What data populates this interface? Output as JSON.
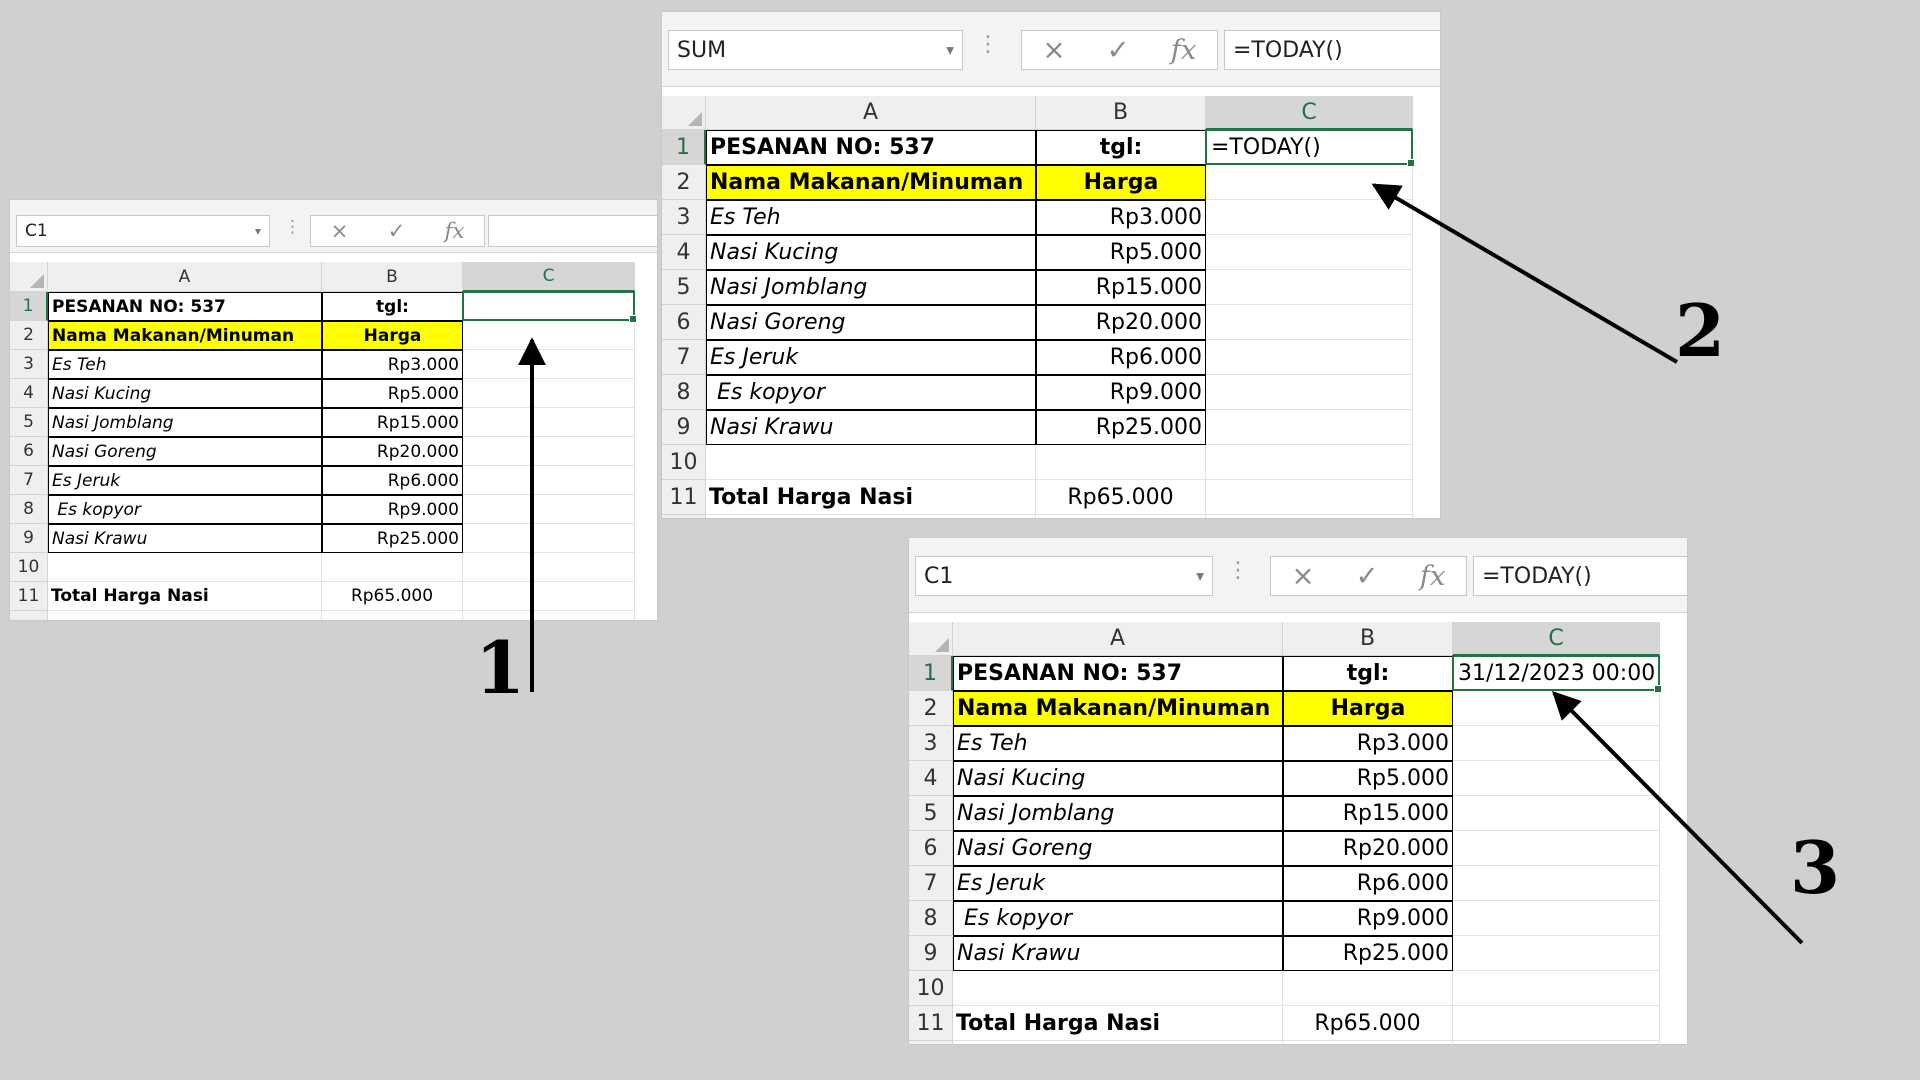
{
  "panels": [
    {
      "name_box": "C1",
      "formula": "",
      "active_value": "",
      "columns": [
        "A",
        "B",
        "C"
      ],
      "rows": [
        "1",
        "2",
        "3",
        "4",
        "5",
        "6",
        "7",
        "8",
        "9",
        "10",
        "11"
      ],
      "title": "PESANAN NO: 537",
      "tgl_label": "tgl:",
      "header_item": "Nama Makanan/Minuman",
      "header_price": "Harga",
      "items": [
        {
          "name": "Es Teh",
          "price": "Rp3.000"
        },
        {
          "name": "Nasi Kucing",
          "price": "Rp5.000"
        },
        {
          "name": "Nasi Jomblang",
          "price": "Rp15.000"
        },
        {
          "name": "Nasi Goreng",
          "price": "Rp20.000"
        },
        {
          "name": "Es Jeruk",
          "price": "Rp6.000"
        },
        {
          "name": " Es kopyor",
          "price": "Rp9.000"
        },
        {
          "name": "Nasi Krawu",
          "price": "Rp25.000"
        }
      ],
      "total_label": "Total Harga Nasi",
      "total_value": "Rp65.000"
    },
    {
      "name_box": "SUM",
      "formula": "=TODAY()",
      "active_value": "=TODAY()",
      "columns": [
        "A",
        "B",
        "C"
      ],
      "rows": [
        "1",
        "2",
        "3",
        "4",
        "5",
        "6",
        "7",
        "8",
        "9",
        "10",
        "11"
      ],
      "title": "PESANAN NO: 537",
      "tgl_label": "tgl:",
      "header_item": "Nama Makanan/Minuman",
      "header_price": "Harga",
      "items": [
        {
          "name": "Es Teh",
          "price": "Rp3.000"
        },
        {
          "name": "Nasi Kucing",
          "price": "Rp5.000"
        },
        {
          "name": "Nasi Jomblang",
          "price": "Rp15.000"
        },
        {
          "name": "Nasi Goreng",
          "price": "Rp20.000"
        },
        {
          "name": "Es Jeruk",
          "price": "Rp6.000"
        },
        {
          "name": " Es kopyor",
          "price": "Rp9.000"
        },
        {
          "name": "Nasi Krawu",
          "price": "Rp25.000"
        }
      ],
      "total_label": "Total Harga Nasi",
      "total_value": "Rp65.000"
    },
    {
      "name_box": "C1",
      "formula": "=TODAY()",
      "active_value": "31/12/2023 00:00",
      "columns": [
        "A",
        "B",
        "C"
      ],
      "rows": [
        "1",
        "2",
        "3",
        "4",
        "5",
        "6",
        "7",
        "8",
        "9",
        "10",
        "11"
      ],
      "title": "PESANAN NO: 537",
      "tgl_label": "tgl:",
      "header_item": "Nama Makanan/Minuman",
      "header_price": "Harga",
      "items": [
        {
          "name": "Es Teh",
          "price": "Rp3.000"
        },
        {
          "name": "Nasi Kucing",
          "price": "Rp5.000"
        },
        {
          "name": "Nasi Jomblang",
          "price": "Rp15.000"
        },
        {
          "name": "Nasi Goreng",
          "price": "Rp20.000"
        },
        {
          "name": "Es Jeruk",
          "price": "Rp6.000"
        },
        {
          "name": " Es kopyor",
          "price": "Rp9.000"
        },
        {
          "name": "Nasi Krawu",
          "price": "Rp25.000"
        }
      ],
      "total_label": "Total Harga Nasi",
      "total_value": "Rp65.000"
    }
  ],
  "step_labels": [
    "1",
    "2",
    "3"
  ],
  "icons": {
    "cancel": "×",
    "enter": "✓",
    "fx": "fx",
    "dropdown": "▾",
    "dots": "⋮"
  },
  "colors": {
    "background": "#d0d0d0",
    "highlight": "#ffff00",
    "selection": "#217346"
  }
}
